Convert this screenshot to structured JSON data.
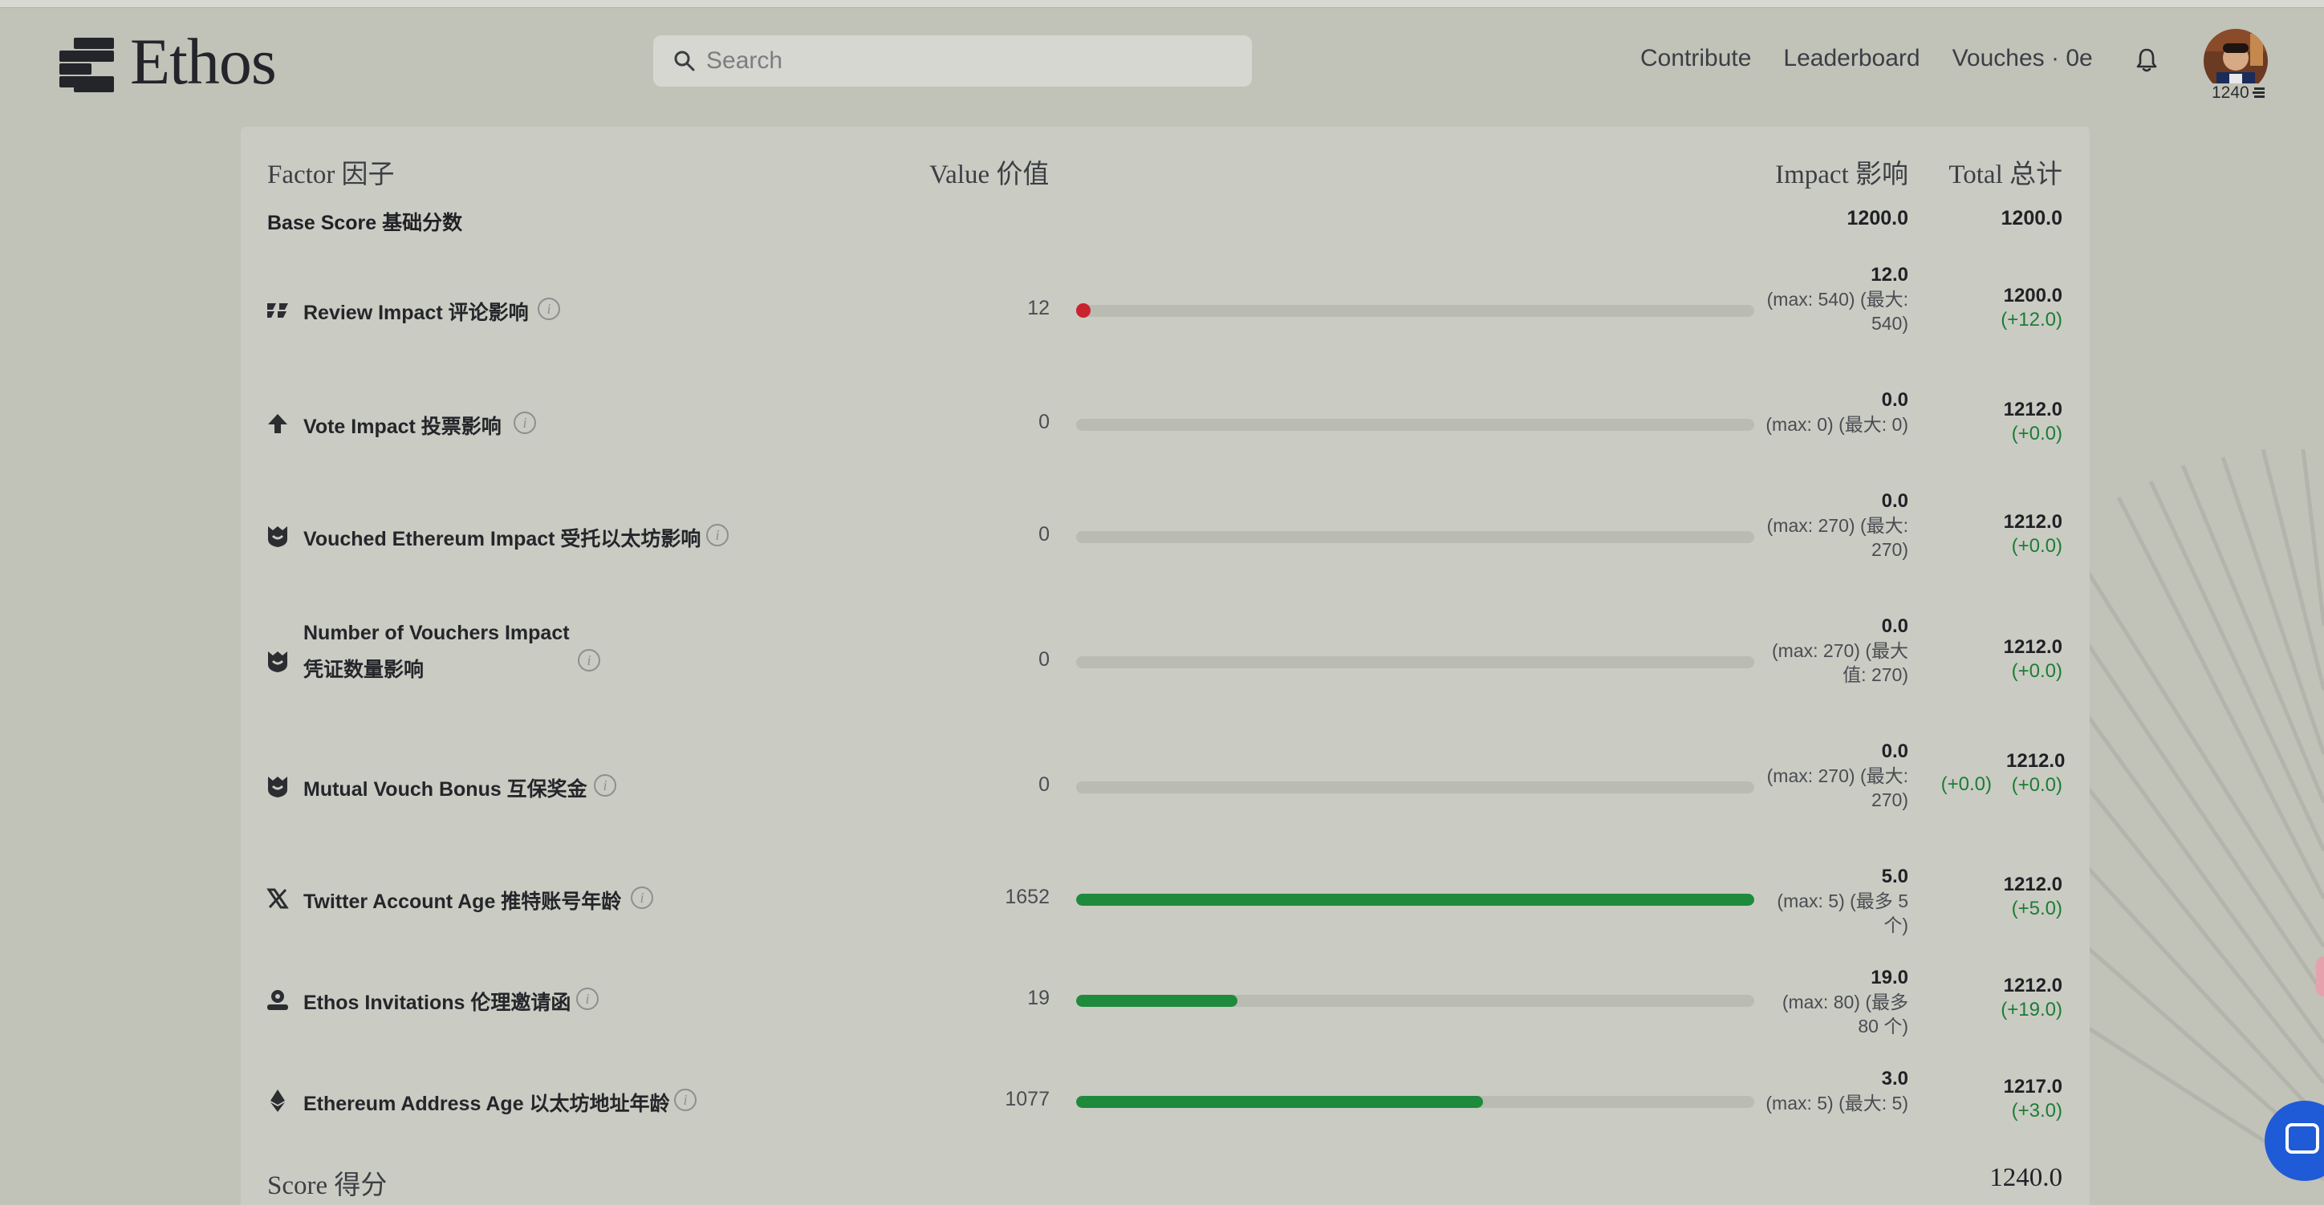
{
  "header": {
    "logo_text": "Ethos",
    "search_placeholder": "Search",
    "nav": [
      "Contribute",
      "Leaderboard",
      "Vouches · 0e"
    ],
    "avatar_score": "1240"
  },
  "table": {
    "headers": {
      "factor": "Factor  因子",
      "value": "Value  价值",
      "impact": "Impact  影响",
      "total": "Total  总计"
    },
    "base": {
      "label": "Base Score  基础分数",
      "impact": "1200.0",
      "total": "1200.0"
    },
    "rows": [
      {
        "label": "Review Impact  评论影响",
        "icon": "review-icon",
        "value": "12",
        "progress": 0.0,
        "indicator": "dot",
        "impact": "12.0",
        "impact_note": "(max: 540) (最大: 540)",
        "total": "1200.0",
        "delta": "(+12.0)"
      },
      {
        "label": "Vote Impact  投票影响",
        "icon": "arrow-up-icon",
        "value": "0",
        "progress": 0.0,
        "indicator": "none",
        "impact": "0.0",
        "impact_note": "(max: 0) (最大: 0)",
        "total": "1212.0",
        "delta": "(+0.0)"
      },
      {
        "label": "Vouched Ethereum Impact  受托以太坊影响",
        "icon": "vouch-icon",
        "value": "0",
        "progress": 0.0,
        "indicator": "none",
        "impact": "0.0",
        "impact_note": "(max: 270) (最大: 270)",
        "total": "1212.0",
        "delta": "(+0.0)"
      },
      {
        "label": "Number of Vouchers Impact  凭证数量影响",
        "icon": "vouch-icon",
        "value": "0",
        "progress": 0.0,
        "indicator": "none",
        "impact": "0.0",
        "impact_note": "(max: 270) (最大值: 270)",
        "total": "1212.0",
        "delta": "(+0.0)"
      },
      {
        "label": "Mutual Vouch Bonus  互保奖金",
        "icon": "vouch-icon",
        "value": "0",
        "progress": 0.0,
        "indicator": "none",
        "impact": "0.0",
        "impact_note": "(max: 270) (最大: 270)",
        "total": "1212.0",
        "delta": "(+0.0)",
        "extra_delta": "(+0.0)"
      },
      {
        "label": "Twitter Account Age  推特账号年龄",
        "icon": "x-twitter-icon",
        "value": "1652",
        "progress": 1.0,
        "indicator": "bar",
        "impact": "5.0",
        "impact_note": "(max: 5) (最多 5 个)",
        "total": "1212.0",
        "delta": "(+5.0)"
      },
      {
        "label": "Ethos Invitations  伦理邀请函",
        "icon": "invitation-icon",
        "value": "19",
        "progress": 0.2375,
        "indicator": "bar",
        "impact": "19.0",
        "impact_note": "(max: 80) (最多 80 个)",
        "total": "1212.0",
        "delta": "(+19.0)"
      },
      {
        "label": "Ethereum Address Age  以太坊地址年龄",
        "icon": "ethereum-icon",
        "value": "1077",
        "progress": 0.6,
        "indicator": "bar",
        "impact": "3.0",
        "impact_note": "(max: 5) (最大: 5)",
        "total": "1217.0",
        "delta": "(+3.0)"
      }
    ],
    "score": {
      "label": "Score  得分",
      "total": "1240.0"
    }
  },
  "colors": {
    "background": "#c1c2b8",
    "card": "#cacbc3",
    "bar_fill": "#1e8a3b",
    "dot": "#c9232e",
    "delta": "#1b7d35",
    "chat": "#1f5bd6"
  }
}
